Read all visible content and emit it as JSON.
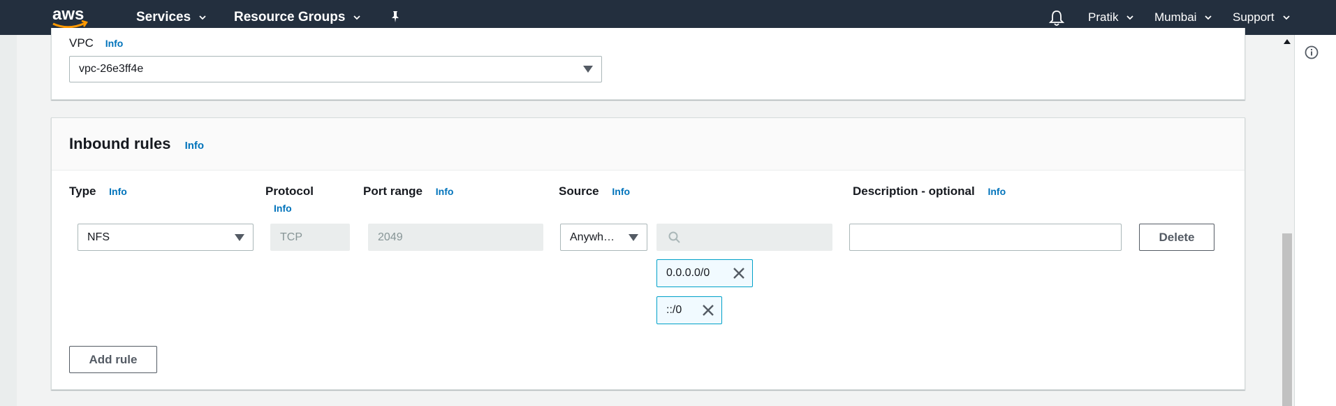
{
  "topnav": {
    "logo_text": "aws",
    "services": "Services",
    "resource_groups": "Resource Groups",
    "user": "Pratik",
    "region": "Mumbai",
    "support": "Support"
  },
  "vpc": {
    "label": "VPC",
    "info": "Info",
    "value": "vpc-26e3ff4e"
  },
  "inbound_rules": {
    "title": "Inbound rules",
    "info": "Info",
    "columns": {
      "type": "Type",
      "type_info": "Info",
      "protocol": "Protocol",
      "protocol_info": "Info",
      "port_range": "Port range",
      "port_range_info": "Info",
      "source": "Source",
      "source_info": "Info",
      "description": "Description - optional",
      "description_info": "Info"
    },
    "rule": {
      "type": "NFS",
      "protocol": "TCP",
      "port_range": "2049",
      "source": "Anywh…",
      "source_tokens": [
        "0.0.0.0/0",
        "::/0"
      ],
      "description": "",
      "delete_label": "Delete"
    },
    "add_rule_label": "Add rule"
  },
  "colors": {
    "nav_bg": "#232f3e",
    "link": "#0073bb",
    "token_border": "#00a1c9",
    "logo_smile": "#ff9900"
  }
}
